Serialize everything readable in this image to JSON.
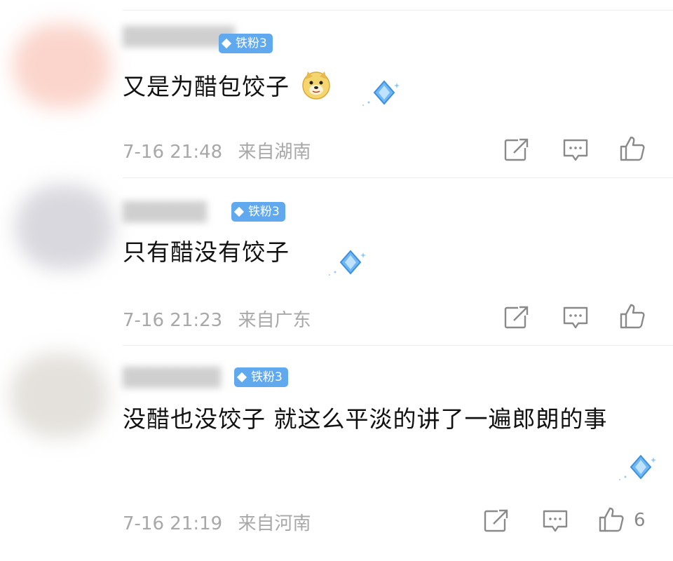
{
  "comments": [
    {
      "badge": "铁粉3",
      "text": "又是为醋包饺子",
      "emoji": "doge-emoji",
      "time": "7-16 21:48",
      "location": "来自湖南",
      "likes": ""
    },
    {
      "badge": "铁粉3",
      "text": "只有醋没有饺子",
      "time": "7-16 21:23",
      "location": "来自广东",
      "likes": ""
    },
    {
      "badge": "铁粉3",
      "text": "没醋也没饺子 就这么平淡的讲了一遍郎朗的事",
      "time": "7-16 21:19",
      "location": "来自河南",
      "likes": "6"
    }
  ],
  "icons": {
    "share": "share-icon",
    "reply": "comment-icon",
    "like": "thumbs-up-icon",
    "badge_gem": "diamond-icon",
    "sticker": "diamond-sparkle-sticker"
  },
  "colors": {
    "badge": "#61a9ee",
    "meta_text": "#a8a8a8",
    "icon": "#8a8a8a"
  }
}
